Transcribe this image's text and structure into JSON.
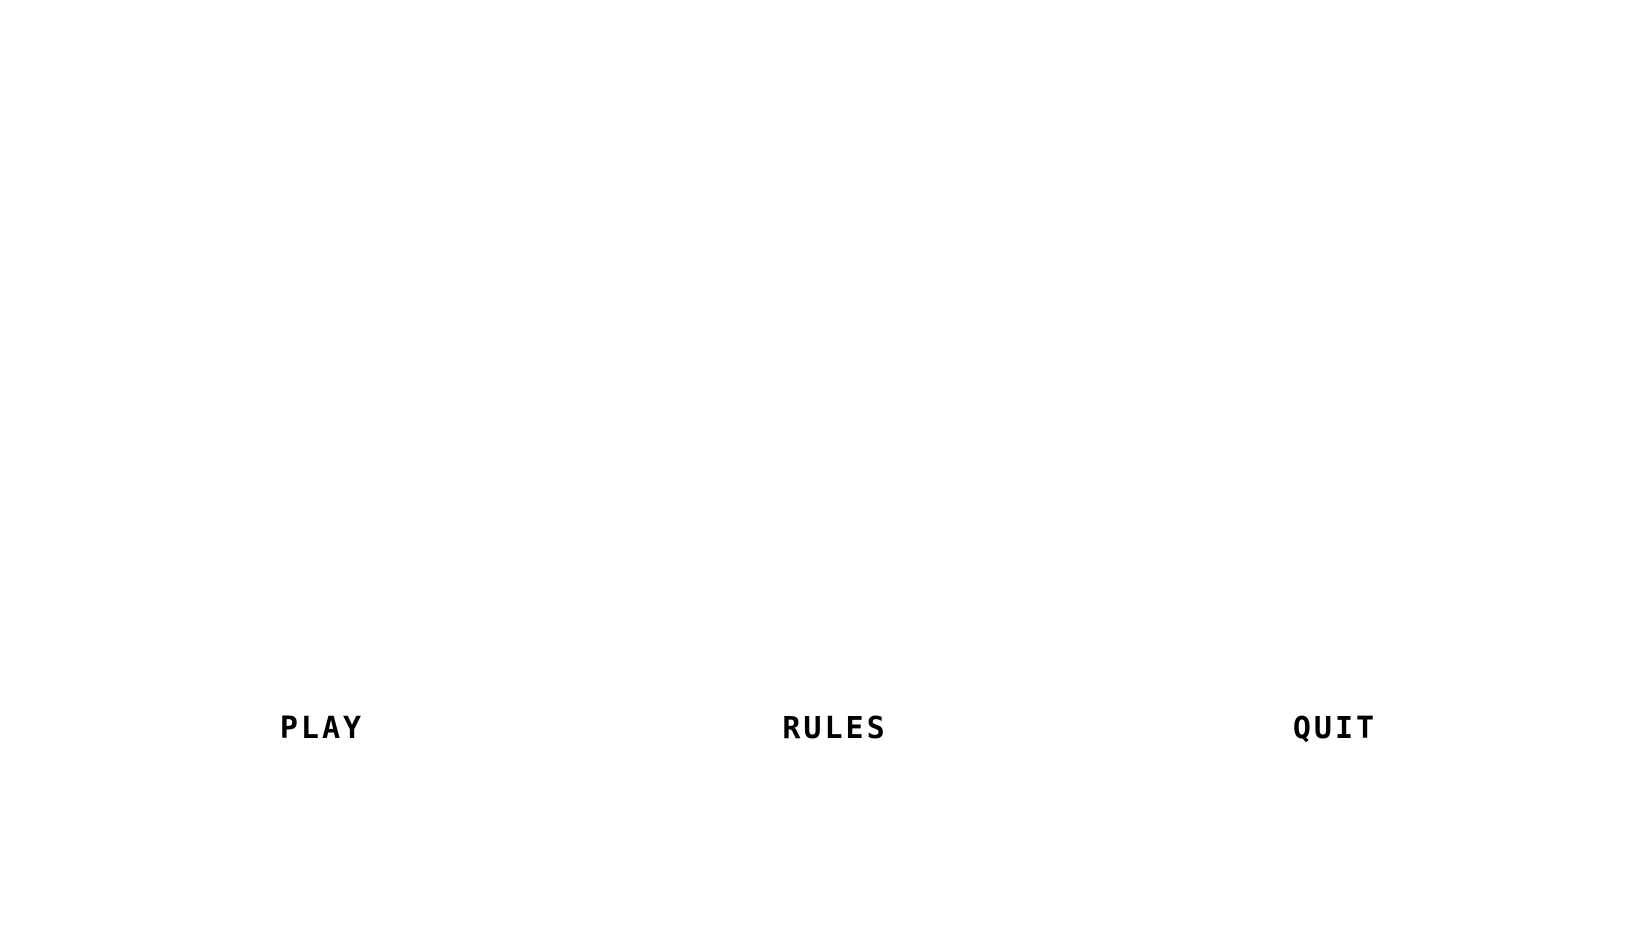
{
  "menu": {
    "play_label": "PLAY",
    "rules_label": "RULES",
    "quit_label": "QUIT"
  },
  "colors": {
    "background": "#ffffff",
    "text": "#000000"
  }
}
